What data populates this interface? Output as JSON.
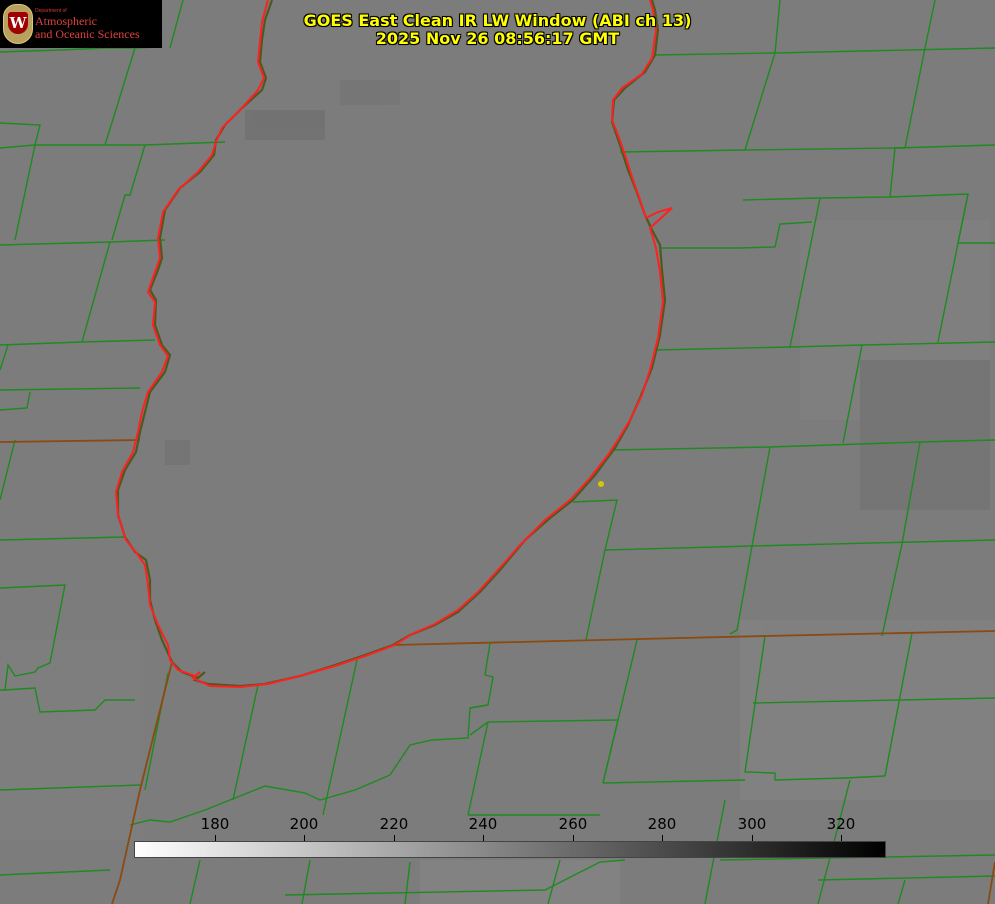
{
  "title": {
    "line1": "GOES East Clean IR LW Window (ABI ch 13)",
    "line2": "2025 Nov 26 08:56:17 GMT"
  },
  "logo": {
    "department": "Department of",
    "name_line1": "Atmospheric",
    "name_line2": "and Oceanic Sciences"
  },
  "colorbar": {
    "ticks": [
      "180",
      "200",
      "220",
      "240",
      "260",
      "280",
      "300",
      "320"
    ],
    "gradient": [
      "#ffffff",
      "#000000"
    ]
  },
  "colors": {
    "background_gray": "#7c7c7c",
    "county_lines": "#1f8a1f",
    "state_lines": "#8a4a10",
    "lake_outline": "#ff2020",
    "marker": "#d4c800",
    "title_text": "#ffff00"
  }
}
